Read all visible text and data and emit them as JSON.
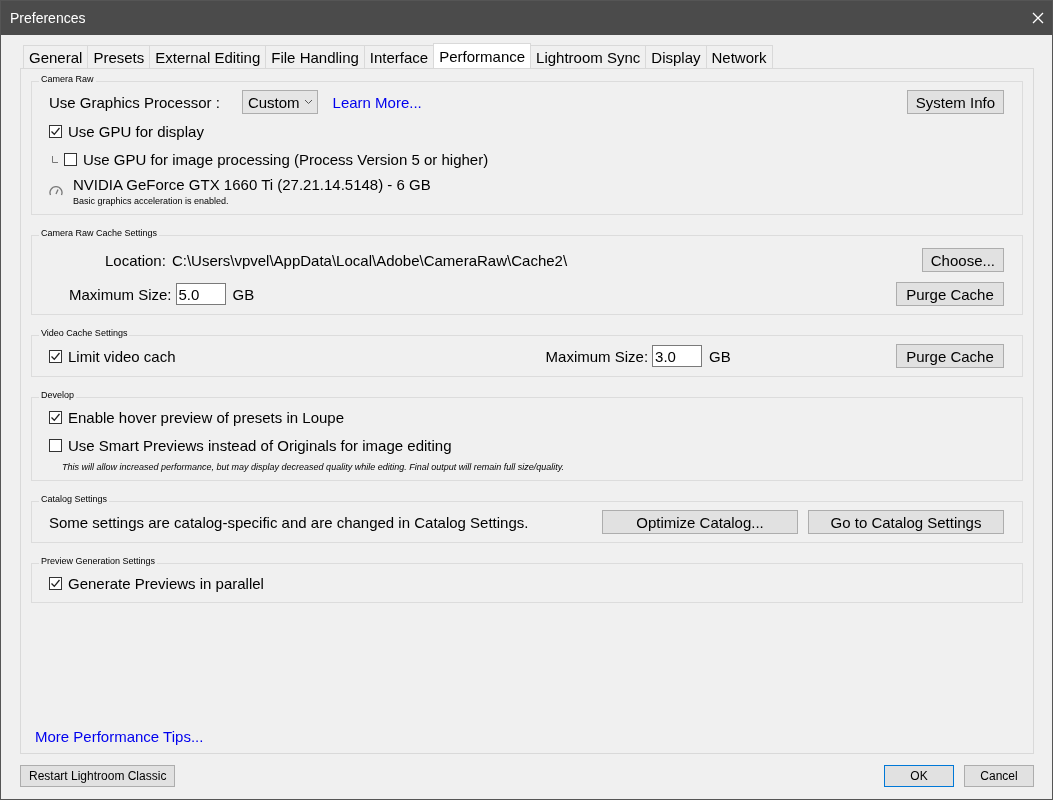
{
  "window": {
    "title": "Preferences"
  },
  "tabs": [
    {
      "label": "General",
      "selected": false
    },
    {
      "label": "Presets",
      "selected": false
    },
    {
      "label": "External Editing",
      "selected": false
    },
    {
      "label": "File Handling",
      "selected": false
    },
    {
      "label": "Interface",
      "selected": false
    },
    {
      "label": "Performance",
      "selected": true
    },
    {
      "label": "Lightroom Sync",
      "selected": false
    },
    {
      "label": "Display",
      "selected": false
    },
    {
      "label": "Network",
      "selected": false
    }
  ],
  "sections": [
    {
      "legend": "Camera Raw",
      "rows": [
        {
          "kind": "select",
          "label": "Use Graphics Processor :",
          "value": "Custom",
          "link": "Learn More...",
          "button": "System Info"
        },
        {
          "kind": "checkbox",
          "label": "Use GPU for display",
          "checked": true
        },
        {
          "kind": "subcheckbox",
          "label": "Use GPU for image processing (Process Version 5 or higher)",
          "checked": false
        },
        {
          "kind": "gpu",
          "name": "NVIDIA GeForce GTX 1660 Ti (27.21.14.5148) - 6 GB",
          "note": "Basic graphics acceleration is enabled."
        }
      ]
    },
    {
      "legend": "Camera Raw Cache Settings",
      "rows": [
        {
          "kind": "location",
          "label": "Location:",
          "path": "C:\\Users\\vpvel\\AppData\\Local\\Adobe\\CameraRaw\\Cache2\\",
          "button": "Choose..."
        },
        {
          "kind": "size",
          "label": "Maximum Size:",
          "value": "5.0",
          "unit": "GB",
          "button": "Purge Cache"
        }
      ]
    },
    {
      "legend": "Video Cache Settings",
      "rows": [
        {
          "kind": "video",
          "label": "Limit video cach",
          "checked": true,
          "size_label": "Maximum Size:",
          "value": "3.0",
          "unit": "GB",
          "button": "Purge Cache"
        }
      ]
    },
    {
      "legend": "Develop",
      "rows": [
        {
          "kind": "checkbox",
          "label": "Enable hover preview of presets in Loupe",
          "checked": true
        },
        {
          "kind": "checkbox",
          "label": "Use Smart Previews instead of Originals for image editing",
          "checked": false
        },
        {
          "kind": "note",
          "text": "This will allow increased performance, but may display decreased quality while editing. Final output will remain full size/quality."
        }
      ]
    },
    {
      "legend": "Catalog Settings",
      "rows": [
        {
          "kind": "catalog",
          "text": "Some settings are catalog-specific and are changed in Catalog Settings.",
          "buttons": [
            "Optimize Catalog...",
            "Go to Catalog Settings"
          ]
        }
      ]
    },
    {
      "legend": "Preview Generation Settings",
      "rows": [
        {
          "kind": "checkbox",
          "label": "Generate Previews in parallel",
          "checked": true
        }
      ]
    }
  ],
  "tips_link": "More Performance Tips...",
  "footer": {
    "restart_button": "Restart Lightroom Classic",
    "buttons": [
      "OK",
      "Cancel"
    ]
  }
}
